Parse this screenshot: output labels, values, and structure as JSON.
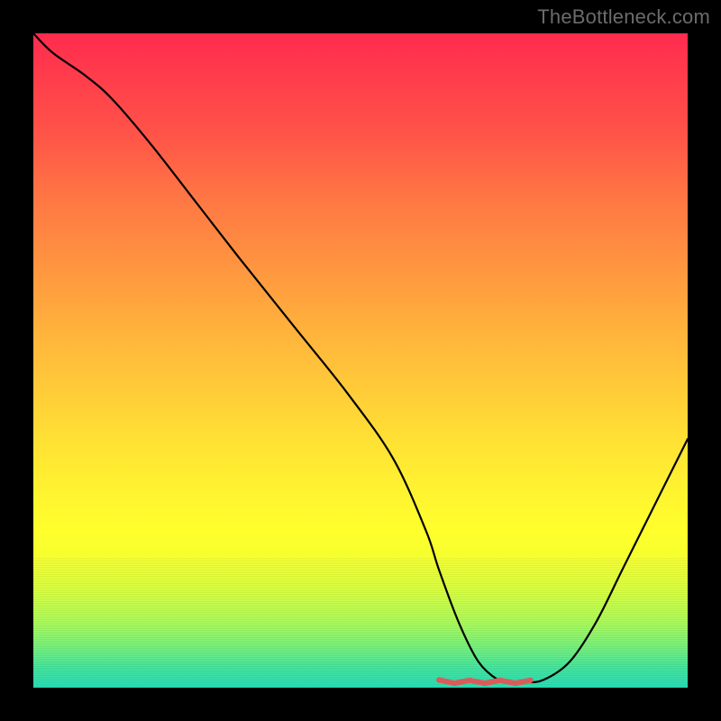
{
  "watermark": "TheBottleneck.com",
  "colors": {
    "background": "#000000",
    "gradient_top": "#ff2b4e",
    "gradient_bottom": "#22dcb2",
    "curve": "#000000",
    "minimum_marker": "#db5b5b",
    "watermark": "#6b6b6b"
  },
  "chart_data": {
    "type": "line",
    "title": "",
    "xlabel": "",
    "ylabel": "",
    "xlim": [
      0,
      100
    ],
    "ylim": [
      0,
      100
    ],
    "grid": false,
    "x": [
      0,
      3,
      8,
      12,
      18,
      25,
      32,
      40,
      48,
      55,
      60,
      62,
      65,
      68,
      71,
      73,
      75,
      78,
      82,
      86,
      90,
      94,
      98,
      100
    ],
    "values": [
      100,
      97,
      93.5,
      90,
      83,
      74,
      65,
      55,
      45,
      35,
      24,
      18,
      10,
      4,
      1.2,
      0.8,
      0.8,
      1.2,
      4,
      10,
      18,
      26,
      34,
      38
    ],
    "minimum_marker": {
      "x_range": [
        62,
        76
      ],
      "y": 0.9,
      "stroke_width_px": 6,
      "color": "#db5b5b"
    },
    "annotations": []
  }
}
